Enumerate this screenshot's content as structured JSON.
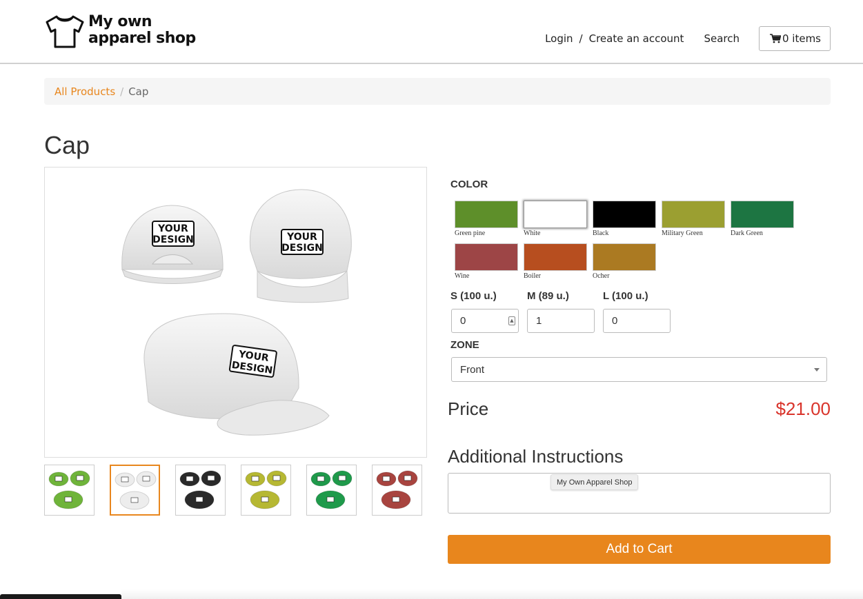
{
  "header": {
    "logo_line1": "My own",
    "logo_line2": "apparel shop",
    "login": "Login",
    "separator": "/",
    "create_account": "Create an account",
    "search": "Search",
    "cart_label": "0 items"
  },
  "breadcrumb": {
    "all_products": "All Products",
    "separator": "/",
    "current": "Cap"
  },
  "product": {
    "title": "Cap",
    "image_texts": [
      "YOUR DESIGN",
      "YOUR DESIGN",
      "YOUR DESIGN"
    ],
    "thumbnail_colors": [
      "#6fb43a",
      "#ededed",
      "#2a2a2a",
      "#b6b833",
      "#1f9a4b",
      "#a8443f"
    ],
    "active_thumbnail_index": 1
  },
  "options": {
    "color_label": "COLOR",
    "colors": [
      {
        "name": "Green pine",
        "hex": "#5e8f2a"
      },
      {
        "name": "White",
        "hex": "#ffffff"
      },
      {
        "name": "Black",
        "hex": "#000000"
      },
      {
        "name": "Military Green",
        "hex": "#9b9f31"
      },
      {
        "name": "Dark Green",
        "hex": "#1d7542"
      },
      {
        "name": "Wine",
        "hex": "#9d4546"
      },
      {
        "name": "Boiler",
        "hex": "#b74e1f"
      },
      {
        "name": "Ocher",
        "hex": "#ab7a22"
      }
    ],
    "selected_color": "White",
    "sizes": [
      {
        "label": "S (100 u.)",
        "value": "0"
      },
      {
        "label": "M (89 u.)",
        "value": "1"
      },
      {
        "label": "L (100 u.)",
        "value": "0"
      }
    ],
    "zone_label": "ZONE",
    "zone_value": "Front"
  },
  "pricing": {
    "label": "Price",
    "value": "$21.00"
  },
  "instructions": {
    "title": "Additional Instructions",
    "value": "",
    "tooltip": "My Own Apparel Shop"
  },
  "actions": {
    "add_to_cart": "Add to Cart"
  },
  "colors": {
    "accent": "#e8861d",
    "price": "#d9342b"
  }
}
